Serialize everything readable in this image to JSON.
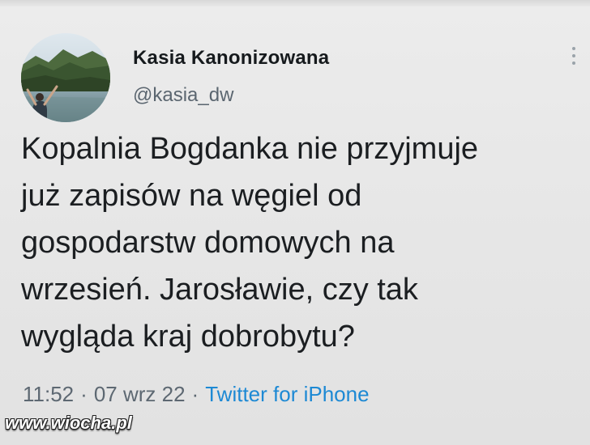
{
  "user": {
    "display_name": "Kasia Kanonizowana",
    "handle": "@kasia_dw"
  },
  "tweet": {
    "lines": [
      "Kopalnia Bogdanka nie przyjmuje",
      "już zapisów na węgiel od",
      "gospodarstw domowych na",
      "wrzesień. Jarosławie, czy tak",
      "wygląda kraj dobrobytu?"
    ],
    "time": "11:52",
    "date": "07 wrz 22",
    "separator": "·",
    "source": "Twitter for iPhone"
  },
  "icons": {
    "more": "more-vertical-icon",
    "avatar": "profile-photo-mountains"
  },
  "watermark": "www.wiocha.pl",
  "colors": {
    "link": "#1d89d4",
    "text": "#1b1e21",
    "muted": "#5d6872"
  }
}
